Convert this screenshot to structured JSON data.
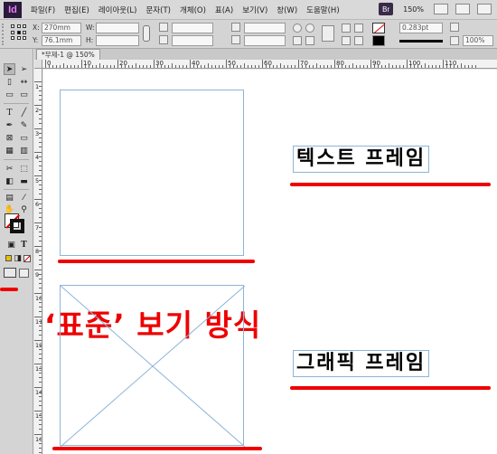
{
  "app": {
    "logo": "Id",
    "bridge_label": "Br",
    "zoom": "150%"
  },
  "menu": [
    "파일(F)",
    "편집(E)",
    "레이아웃(L)",
    "문자(T)",
    "개체(O)",
    "표(A)",
    "보기(V)",
    "창(W)",
    "도움말(H)"
  ],
  "control": {
    "x_label": "X:",
    "x_value": "270mm",
    "y_label": "Y:",
    "y_value": "76.1mm",
    "w_label": "W:",
    "h_label": "H:",
    "stroke_weight": "0.283pt",
    "opacity": "100%"
  },
  "document": {
    "tab_title": "*무제-1 @ 150%"
  },
  "ruler": {
    "h_labels": [
      "0",
      "10",
      "20",
      "30",
      "40",
      "50",
      "60",
      "70",
      "80",
      "90",
      "100",
      "110"
    ],
    "v_labels": [
      "1",
      "2",
      "3",
      "4",
      "5",
      "6",
      "7",
      "8",
      "9",
      "10",
      "11",
      "12",
      "13",
      "14",
      "15",
      "16"
    ]
  },
  "canvas": {
    "text_frame_label": "텍스트 프레임",
    "graphic_frame_label": "그래픽 프레임",
    "view_mode_annotation": "‘표준’ 보기 방식"
  },
  "colors": {
    "accent_red": "#e00000",
    "frame_blue": "#8db4d8"
  }
}
